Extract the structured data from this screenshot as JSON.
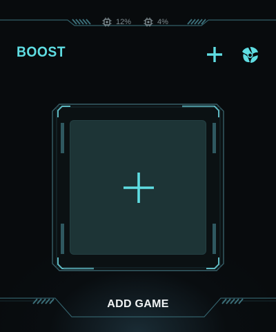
{
  "status": {
    "cpu": {
      "icon": "processor-icon",
      "value": "12%"
    },
    "ram": {
      "icon": "processor-icon",
      "value": "4%"
    }
  },
  "header": {
    "title": "BOOST",
    "add_icon": "plus-icon",
    "settings_icon": "fan-icon"
  },
  "slot": {
    "icon": "plus-icon"
  },
  "bottom": {
    "add_game_label": "ADD GAME"
  },
  "colors": {
    "background": "#080b0d",
    "accent": "#5fdde2",
    "slot_fill": "#1d3436",
    "frame": "#3a6f78",
    "muted_text": "#7f8d92",
    "label_text": "#f1f4f5"
  }
}
